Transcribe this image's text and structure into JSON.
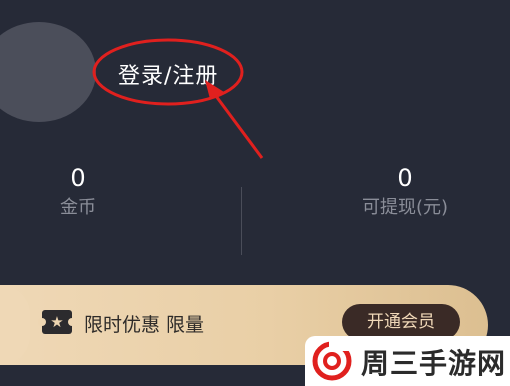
{
  "profile": {
    "login_register_label": "登录/注册"
  },
  "stats": [
    {
      "value": "0",
      "label": "金币"
    },
    {
      "value": "0",
      "label": "可提现(元)"
    }
  ],
  "vip_banner": {
    "text": "限时优惠 限量",
    "button_label": "开通会员",
    "icon": "star-ticket-icon"
  },
  "annotation": {
    "color": "#e0201e"
  },
  "watermark": {
    "text": "周三手游网",
    "logo_color": "#e0201e"
  }
}
